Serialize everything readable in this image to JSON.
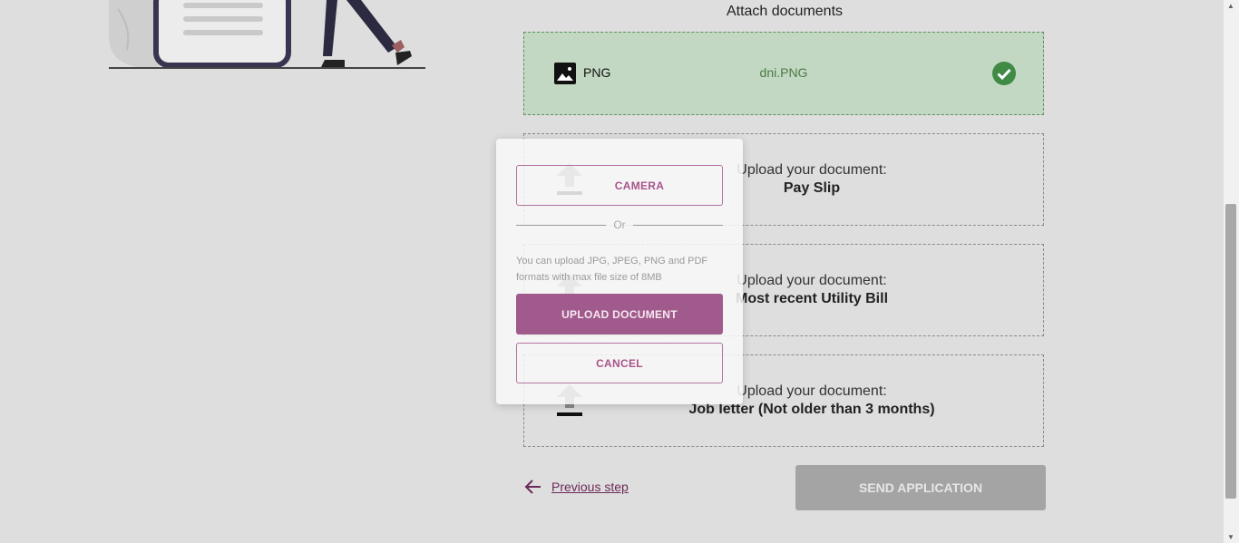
{
  "section_title": "Attach documents",
  "uploaded": {
    "file_type": "PNG",
    "file_name": "dni.PNG"
  },
  "pending_docs": [
    {
      "label": "Upload your document:",
      "name": "Pay Slip"
    },
    {
      "label": "Upload your document:",
      "name": "Most recent Utility Bill"
    },
    {
      "label": "Upload your document:",
      "name": "Job letter (Not older than 3 months)"
    }
  ],
  "nav": {
    "previous_label": "Previous step",
    "send_label": "SEND APPLICATION"
  },
  "modal": {
    "camera_label": "CAMERA",
    "or_label": "Or",
    "info": "You can upload JPG, JPEG, PNG and PDF formats with max file size of 8MB",
    "upload_label": "UPLOAD DOCUMENT",
    "cancel_label": "CANCEL"
  },
  "colors": {
    "accent": "#a05a8c",
    "success_bg": "#c3d8c2",
    "success_icon": "#3f8a45",
    "link": "#6c2a58",
    "disabled_button": "#a4a4a4"
  },
  "icons": [
    "image-icon",
    "check-circle-icon",
    "upload-icon",
    "arrow-left-icon"
  ]
}
